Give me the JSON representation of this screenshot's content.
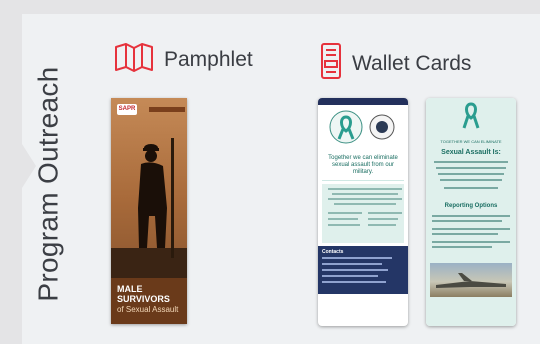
{
  "section_title": "Program Outreach",
  "headers": {
    "pamphlet_label": "Pamphlet",
    "wallet_label": "Wallet Cards"
  },
  "icons": {
    "pamphlet": "map-fold-icon",
    "wallet": "wallet-card-icon"
  },
  "colors": {
    "accent": "#e6323c",
    "navy": "#243666",
    "teal": "#1a6e62"
  },
  "pamphlet": {
    "caption": "MALE SURVIVORS",
    "subcaption": "of Sexual Assault"
  },
  "card_left": {
    "heading": "Together we can eliminate sexual assault from our military.",
    "contacts_label": "Contacts"
  },
  "card_right": {
    "heading": "Sexual Assault Is:",
    "options_label": "Reporting Options"
  }
}
